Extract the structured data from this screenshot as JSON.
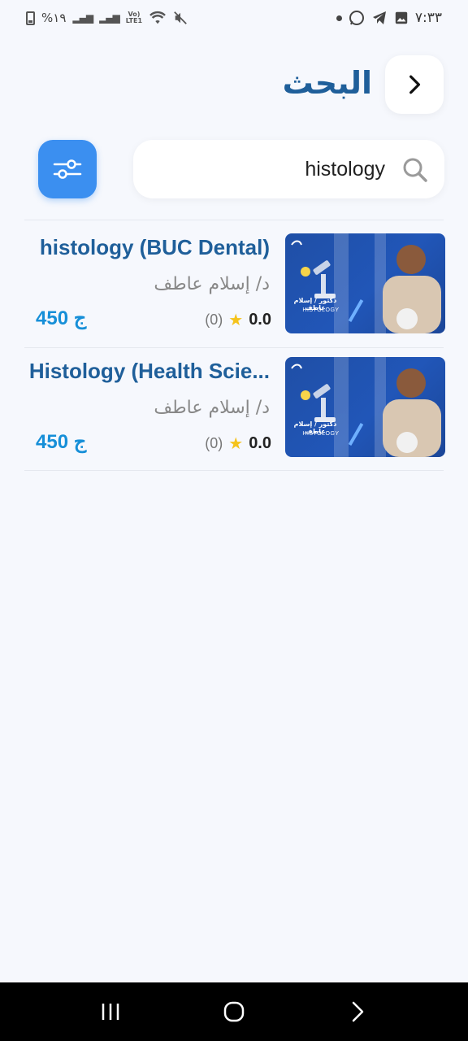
{
  "status_bar": {
    "battery": "%١٩",
    "time": "٧:٣٣",
    "lte": "LTE1"
  },
  "header": {
    "title": "البحث"
  },
  "search": {
    "value": "histology",
    "placeholder": ""
  },
  "thumbnail": {
    "doctor_label": "دكتور / إسلام عاطف",
    "subject_label": "HISTOLOGY"
  },
  "results": [
    {
      "title": "histology (BUC Dental)",
      "instructor": "د/ إسلام عاطف",
      "rating": "0.0",
      "rating_count": "(0)",
      "price": "450 ج"
    },
    {
      "title": "Histology (Health Scie...",
      "instructor": "د/ إسلام عاطف",
      "rating": "0.0",
      "rating_count": "(0)",
      "price": "450 ج"
    }
  ],
  "colors": {
    "accent": "#3b8ff0",
    "title": "#1f5f9a",
    "price": "#168fd8",
    "star": "#f5c31b"
  }
}
